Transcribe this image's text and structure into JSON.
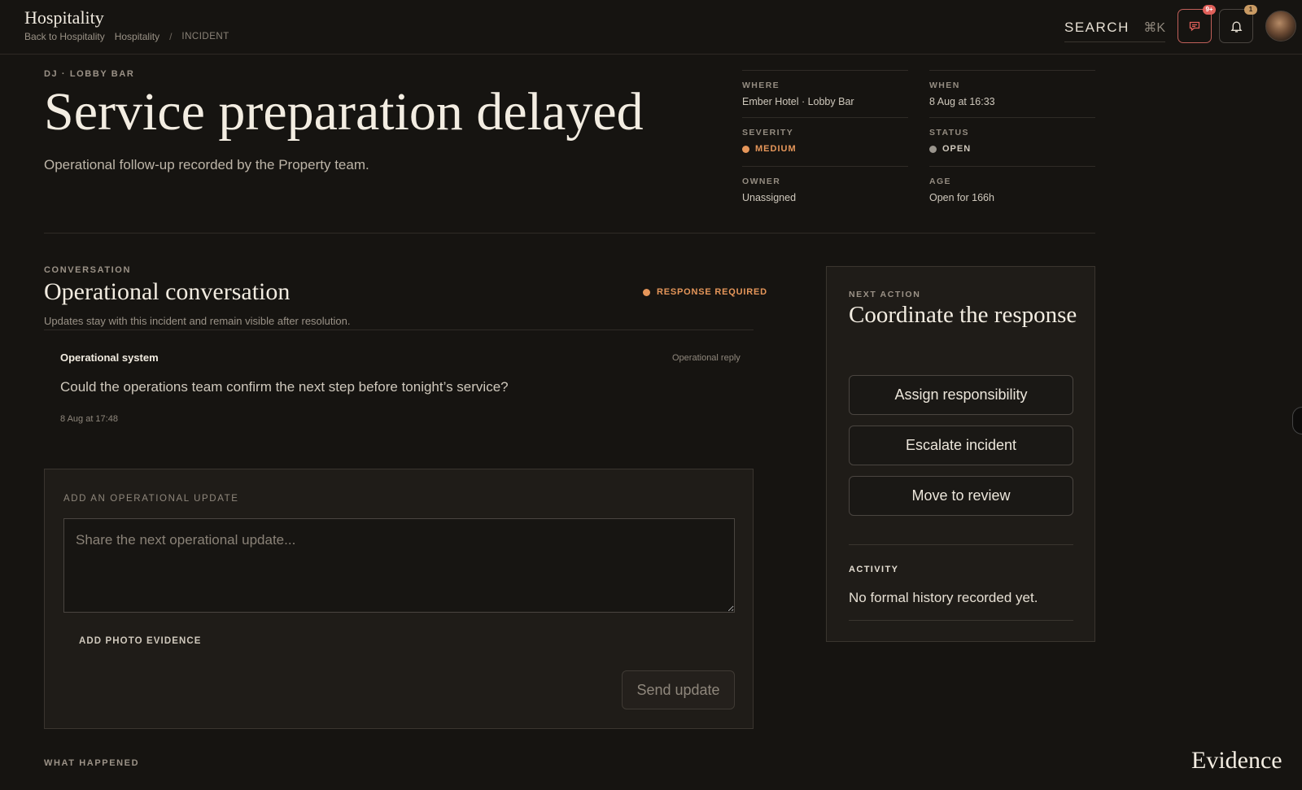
{
  "header": {
    "brand": "Hospitality",
    "back_link": "Back to Hospitality",
    "crumb_parent": "Hospitality",
    "crumb_separator": "/",
    "crumb_current": "INCIDENT",
    "search_label": "SEARCH",
    "search_shortcut": "⌘K",
    "messages_badge": "9+",
    "notifications_badge": "1"
  },
  "incident": {
    "eyebrow": "DJ · LOBBY BAR",
    "title": "Service preparation delayed",
    "subtitle": "Operational follow-up recorded by the Property team.",
    "facts": {
      "where_label": "WHERE",
      "where_value": "Ember Hotel · Lobby Bar",
      "when_label": "WHEN",
      "when_value": "8 Aug at 16:33",
      "severity_label": "SEVERITY",
      "severity_value": "MEDIUM",
      "status_label": "STATUS",
      "status_value": "OPEN",
      "owner_label": "OWNER",
      "owner_value": "Unassigned",
      "age_label": "AGE",
      "age_value": "Open for 166h"
    }
  },
  "conversation": {
    "eyebrow": "CONVERSATION",
    "title": "Operational conversation",
    "subtitle": "Updates stay with this incident and remain visible after resolution.",
    "response_flag": "RESPONSE REQUIRED",
    "message": {
      "author": "Operational system",
      "kind": "Operational reply",
      "body": "Could the operations team confirm the next step before tonight’s service?",
      "time": "8 Aug at 17:48"
    }
  },
  "composer": {
    "eyebrow": "ADD AN OPERATIONAL UPDATE",
    "placeholder": "Share the next operational update...",
    "photo_label": "ADD PHOTO EVIDENCE",
    "send_label": "Send update"
  },
  "panel": {
    "eyebrow": "NEXT ACTION",
    "title": "Coordinate the response",
    "buttons": [
      "Assign responsibility",
      "Escalate incident",
      "Move to review"
    ],
    "activity_label": "ACTIVITY",
    "activity_text": "No formal history recorded yet."
  },
  "footer": {
    "what_happened": "WHAT HAPPENED",
    "evidence": "Evidence"
  },
  "colors": {
    "background": "#161411",
    "accent_orange": "#e5965a",
    "status_grey": "#9a958d",
    "alert_red": "#e0605a"
  }
}
